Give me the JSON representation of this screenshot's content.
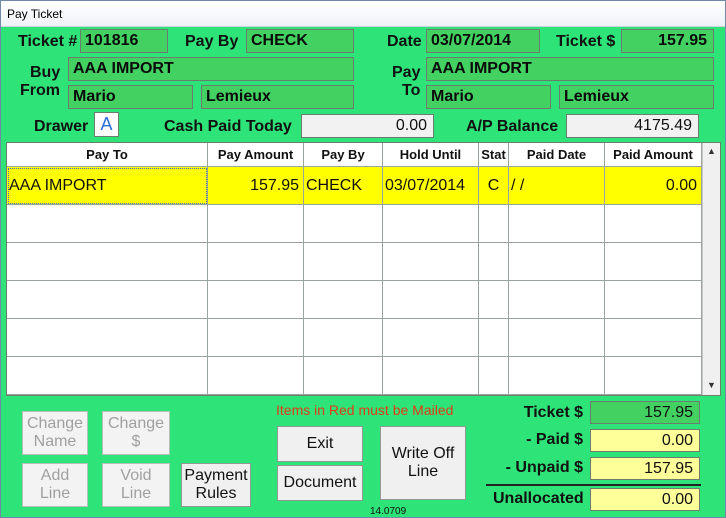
{
  "window": {
    "title": "Pay Ticket"
  },
  "header": {
    "ticket_label": "Ticket #",
    "ticket_value": "101816",
    "pay_by_label": "Pay By",
    "pay_by_value": "CHECK",
    "date_label": "Date",
    "date_value": "03/07/2014",
    "ticket_amount_label": "Ticket $",
    "ticket_amount_value": "157.95",
    "buy_label": "Buy",
    "from_label": "From",
    "buy_from_company": "AAA IMPORT",
    "buy_from_first": "Mario",
    "buy_from_last": "Lemieux",
    "pay_label": "Pay",
    "to_label": "To",
    "pay_to_company": "AAA IMPORT",
    "pay_to_first": "Mario",
    "pay_to_last": "Lemieux",
    "drawer_label": "Drawer",
    "drawer_value": "A",
    "cash_paid_label": "Cash Paid Today",
    "cash_paid_value": "0.00",
    "ap_balance_label": "A/P Balance",
    "ap_balance_value": "4175.49"
  },
  "grid": {
    "columns": [
      "Pay To",
      "Pay Amount",
      "Pay By",
      "Hold Until",
      "Stat",
      "Paid Date",
      "Paid Amount"
    ],
    "rows": [
      [
        "AAA IMPORT",
        "157.95",
        "CHECK",
        "03/07/2014",
        "C",
        "/ /",
        "0.00"
      ],
      [
        "",
        "",
        "",
        "",
        "",
        "",
        ""
      ],
      [
        "",
        "",
        "",
        "",
        "",
        "",
        ""
      ],
      [
        "",
        "",
        "",
        "",
        "",
        "",
        ""
      ],
      [
        "",
        "",
        "",
        "",
        "",
        "",
        ""
      ],
      [
        "",
        "",
        "",
        "",
        "",
        "",
        ""
      ]
    ],
    "scroll_up": "▲",
    "scroll_down": "▼"
  },
  "buttons": {
    "change_name": "Change\nName",
    "change_amount": "Change\n$",
    "add_line": "Add\nLine",
    "void_line": "Void\nLine",
    "payment_rules": "Payment\nRules",
    "exit": "Exit",
    "document": "Document",
    "write_off_line": "Write  Off\nLine"
  },
  "notice": "Items in Red must be Mailed",
  "version": "14.0709",
  "summary": {
    "ticket_label": "Ticket $",
    "ticket_value": "157.95",
    "paid_label": "- Paid $",
    "paid_value": "0.00",
    "unpaid_label": "- Unpaid $",
    "unpaid_value": "157.95",
    "unallocated_label": "Unallocated",
    "unallocated_value": "0.00"
  },
  "colors": {
    "form_background": "#2ee478",
    "field_green": "#43d261",
    "selected_row": "#ffff00",
    "summary_yellow": "#ffff99",
    "notice_red": "#e23a1a"
  }
}
